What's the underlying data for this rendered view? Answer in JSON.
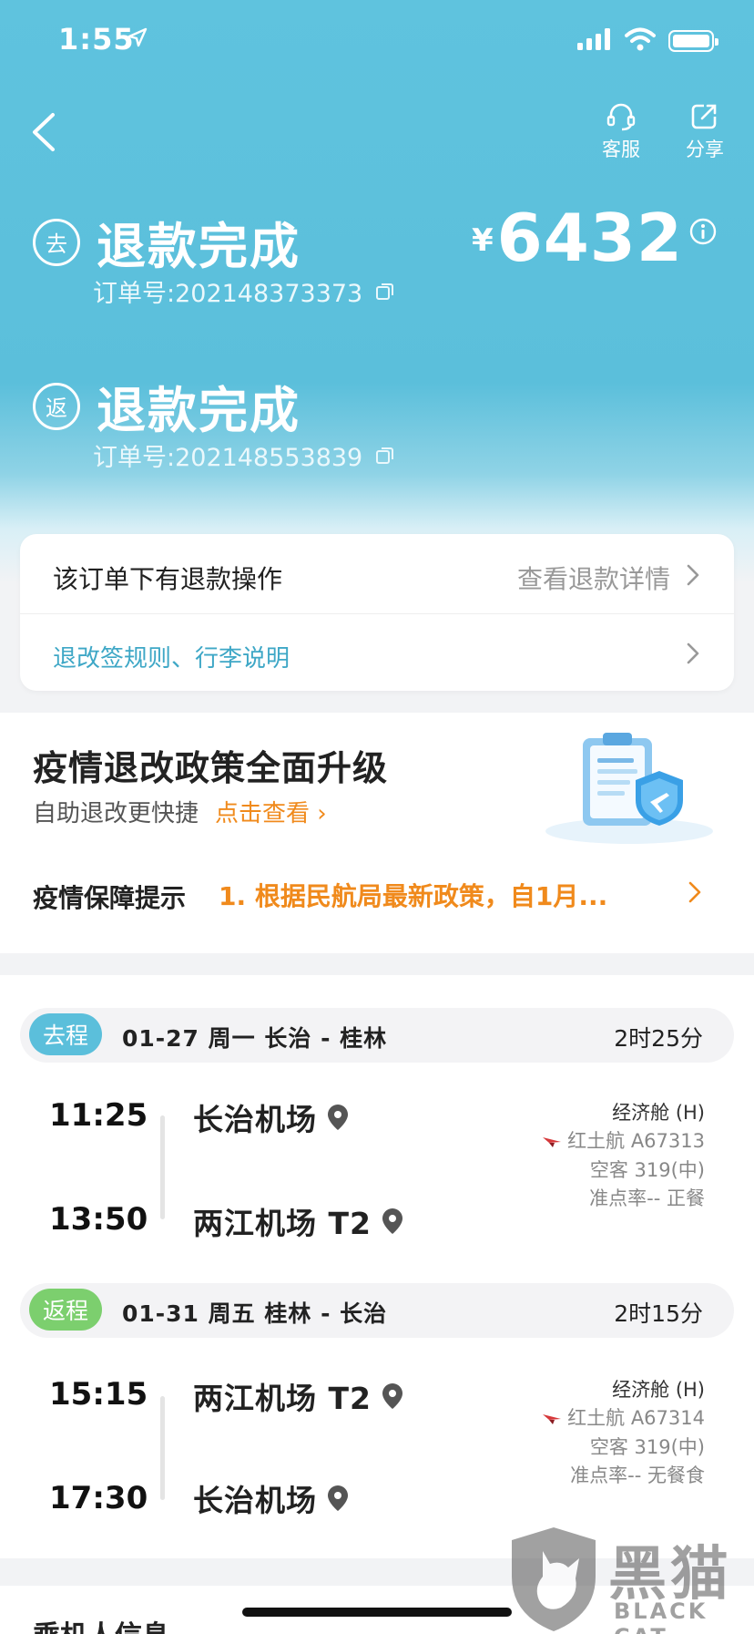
{
  "status_bar": {
    "time": "1:55"
  },
  "nav": {
    "service_label": "客服",
    "share_label": "分享"
  },
  "outbound": {
    "tag": "去",
    "status": "退款完成",
    "order_number": "订单号:202148373373"
  },
  "return": {
    "tag": "返",
    "status": "退款完成",
    "order_number": "订单号:202148553839"
  },
  "amount": {
    "currency": "¥",
    "value": "6432"
  },
  "refund_card": {
    "notice": "该订单下有退款操作",
    "details_link": "查看退款详情",
    "rules_link": "退改签规则、行李说明"
  },
  "promo": {
    "title": "疫情退改政策全面升级",
    "subtitle": "自助退改更快捷",
    "link": "点击查看 ›",
    "tip_label": "疫情保障提示",
    "tip_text": "1. 根据民航局最新政策，自1月..."
  },
  "segments": [
    {
      "tag": "去程",
      "tag_color": "#5bbfdb",
      "date_route": "01-27  周一  长治 - 桂林",
      "duration": "2时25分",
      "depart_time": "11:25",
      "arrive_time": "13:50",
      "depart_airport": "长治机场",
      "arrive_airport": "两江机场 T2",
      "cabin": "经济舱 (H)",
      "airline": "红土航 A67313",
      "aircraft": "空客 319(中)",
      "punctuality": "准点率-- 正餐"
    },
    {
      "tag": "返程",
      "tag_color": "#7ccf6e",
      "date_route": "01-31  周五  桂林 - 长治",
      "duration": "2时15分",
      "depart_time": "15:15",
      "arrive_time": "17:30",
      "depart_airport": "两江机场 T2",
      "arrive_airport": "长治机场",
      "cabin": "经济舱 (H)",
      "airline": "红土航 A67314",
      "aircraft": "空客 319(中)",
      "punctuality": "准点率-- 无餐食"
    }
  ],
  "passenger": {
    "title": "乘机人信息"
  },
  "watermark": {
    "text": "黑猫",
    "sub": "BLACK CAT"
  }
}
